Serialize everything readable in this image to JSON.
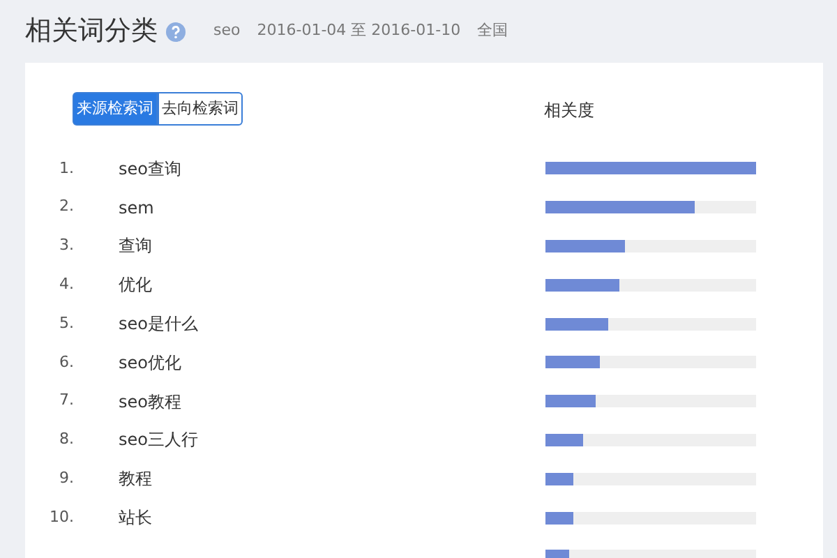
{
  "header": {
    "title": "相关词分类",
    "keyword": "seo",
    "date_range": "2016-01-04 至 2016-01-10",
    "region": "全国"
  },
  "toggle": [
    {
      "label": "来源检索词",
      "selected": true
    },
    {
      "label": "去向检索词",
      "selected": false
    }
  ],
  "column_header": "相关度",
  "rows": [
    {
      "rank": "1.",
      "term": "seo查询",
      "level": 1.0
    },
    {
      "rank": "2.",
      "term": "sem",
      "level": 0.71
    },
    {
      "rank": "3.",
      "term": "查询",
      "level": 0.38
    },
    {
      "rank": "4.",
      "term": "优化",
      "level": 0.35
    },
    {
      "rank": "5.",
      "term": "seo是什么",
      "level": 0.3
    },
    {
      "rank": "6.",
      "term": "seo优化",
      "level": 0.26
    },
    {
      "rank": "7.",
      "term": "seo教程",
      "level": 0.24
    },
    {
      "rank": "8.",
      "term": "seo三人行",
      "level": 0.18
    },
    {
      "rank": "9.",
      "term": "教程",
      "level": 0.13
    },
    {
      "rank": "10.",
      "term": "站长",
      "level": 0.13
    },
    {
      "level": 0.11
    }
  ]
}
